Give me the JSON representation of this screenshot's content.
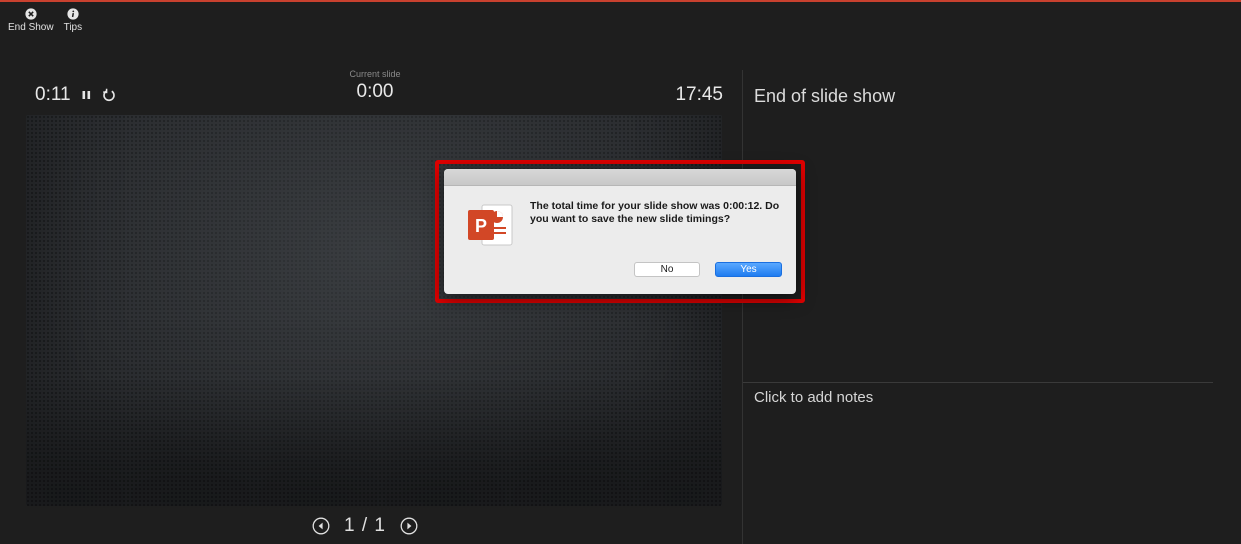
{
  "toolbar": {
    "end_show_label": "End Show",
    "tips_label": "Tips"
  },
  "timers": {
    "elapsed": "0:11",
    "current_slide_label": "Current slide",
    "current_slide_time": "0:00",
    "clock": "17:45"
  },
  "navigation": {
    "counter": "1 / 1"
  },
  "panel": {
    "next_slide_title": "End of slide show",
    "notes_placeholder": "Click to add notes"
  },
  "dialog": {
    "message": "The total time for your slide show was 0:00:12. Do you want to save the new slide timings?",
    "no_label": "No",
    "yes_label": "Yes"
  },
  "colors": {
    "background": "#1e1e1e",
    "highlight": "#e00000",
    "accent_button": "#1f7cf0",
    "powerpoint_brand": "#d24726"
  },
  "icons": [
    "close-circle-icon",
    "info-icon",
    "pause-icon",
    "restart-icon",
    "prev-slide-icon",
    "next-slide-icon",
    "powerpoint-icon"
  ]
}
